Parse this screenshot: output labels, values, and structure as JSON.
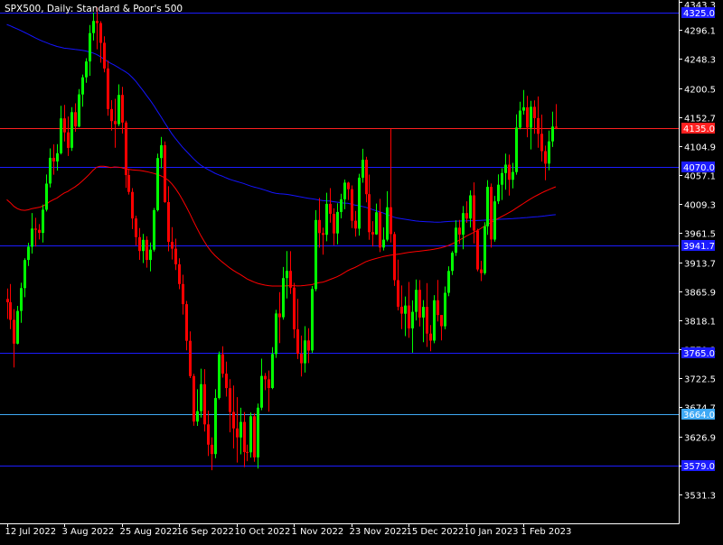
{
  "header": {
    "title": "SPX500, Daily:  Standard & Poor's 500"
  },
  "chart_data": {
    "type": "candlestick",
    "symbol": "SPX500",
    "timeframe": "Daily",
    "instrument": "Standard & Poor's 500",
    "y_ticks": [
      "4343.3",
      "4296.1",
      "4248.3",
      "4200.5",
      "4152.7",
      "4104.9",
      "4057.1",
      "4009.3",
      "3961.5",
      "3913.7",
      "3865.9",
      "3818.1",
      "3770.3",
      "3722.5",
      "3674.7",
      "3626.9",
      "3579.1",
      "3531.3"
    ],
    "ylim": [
      3483.6,
      4345.6
    ],
    "x_ticks": [
      {
        "label": "12 Jul 2022",
        "bar": 0
      },
      {
        "label": "3 Aug 2022",
        "bar": 16
      },
      {
        "label": "25 Aug 2022",
        "bar": 32
      },
      {
        "label": "16 Sep 2022",
        "bar": 48
      },
      {
        "label": "10 Oct 2022",
        "bar": 64
      },
      {
        "label": "1 Nov 2022",
        "bar": 80
      },
      {
        "label": "23 Nov 2022",
        "bar": 96
      },
      {
        "label": "15 Dec 2022",
        "bar": 112
      },
      {
        "label": "10 Jan 2023",
        "bar": 128
      },
      {
        "label": "1 Feb 2023",
        "bar": 144
      }
    ],
    "horizontal_lines": [
      {
        "value": 4325.0,
        "label": "4325.0",
        "color": "#1c1cff",
        "label_bg": "#1c1cff"
      },
      {
        "value": 4135.0,
        "label": "4135.0",
        "color": "#ff2020",
        "label_bg": "#ff2020"
      },
      {
        "value": 4070.0,
        "label": "4070.0",
        "color": "#1c1cff",
        "label_bg": "#1c1cff"
      },
      {
        "value": 3941.7,
        "label": "3941.7",
        "color": "#1c1cff",
        "label_bg": "#1c1cff"
      },
      {
        "value": 3765.0,
        "label": "3765.0",
        "color": "#1c1cff",
        "label_bg": "#1c1cff"
      },
      {
        "value": 3664.0,
        "label": "3664.0",
        "color": "#3fa9f5",
        "label_bg": "#3fa9f5"
      },
      {
        "value": 3579.0,
        "label": "3579.0",
        "color": "#1c1cff",
        "label_bg": "#1c1cff"
      }
    ],
    "colors": {
      "background": "#000000",
      "up": "#00ff00",
      "down": "#ff0000",
      "text": "#ffffff",
      "ma_fast": "#ff0000",
      "ma_slow": "#1414ff"
    },
    "candles": [
      [
        3853.2,
        3870.5,
        3820.2,
        3847.7
      ],
      [
        3847.7,
        3877.9,
        3803.6,
        3818.7
      ],
      [
        3818.7,
        3836.4,
        3740.3,
        3779.6
      ],
      [
        3779.6,
        3841.8,
        3778.4,
        3833.5
      ],
      [
        3833.5,
        3879.8,
        3814.0,
        3871.1
      ],
      [
        3871.1,
        3920.2,
        3856.1,
        3917.3
      ],
      [
        3917.3,
        3945.8,
        3907.6,
        3939.2
      ],
      [
        3939.2,
        3994.7,
        3928.0,
        3969.1
      ],
      [
        3969.1,
        3986.8,
        3939.4,
        3967.0
      ],
      [
        3967.0,
        3976.4,
        3951.1,
        3962.0
      ],
      [
        3962.0,
        4008.7,
        3946.3,
        4000.2
      ],
      [
        4000.2,
        4058.2,
        3997.3,
        4043.2
      ],
      [
        4043.2,
        4101.1,
        4036.8,
        4085.6
      ],
      [
        4085.6,
        4107.8,
        4057.8,
        4079.7
      ],
      [
        4079.7,
        4108.2,
        4064.6,
        4093.2
      ],
      [
        4093.2,
        4171.3,
        4091.3,
        4150.6
      ],
      [
        4150.6,
        4172.7,
        4112.6,
        4127.6
      ],
      [
        4127.6,
        4153.8,
        4088.6,
        4102.1
      ],
      [
        4102.1,
        4169.0,
        4096.9,
        4160.8
      ],
      [
        4160.8,
        4175.5,
        4128.6,
        4137.2
      ],
      [
        4137.2,
        4198.8,
        4135.9,
        4190.1
      ],
      [
        4190.1,
        4222.8,
        4169.9,
        4218.3
      ],
      [
        4218.3,
        4249.8,
        4209.2,
        4244.4
      ],
      [
        4244.4,
        4304.4,
        4220.8,
        4291.1
      ],
      [
        4291.1,
        4324.6,
        4278.8,
        4311.1
      ],
      [
        4311.1,
        4333.4,
        4264.4,
        4307.6
      ],
      [
        4307.6,
        4310.6,
        4242.3,
        4275.1
      ],
      [
        4275.1,
        4285.8,
        4226.6,
        4232.8
      ],
      [
        4232.8,
        4245.6,
        4155.0,
        4166.1
      ],
      [
        4166.1,
        4180.6,
        4130.4,
        4146.2
      ],
      [
        4146.2,
        4182.9,
        4102.1,
        4141.2
      ],
      [
        4141.2,
        4206.7,
        4137.9,
        4189.3
      ],
      [
        4189.3,
        4202.6,
        4125.6,
        4143.8
      ],
      [
        4143.8,
        4146.8,
        4036.0,
        4057.3
      ],
      [
        4057.3,
        4067.9,
        4025.1,
        4029.5
      ],
      [
        4029.5,
        4035.8,
        3968.3,
        3985.8
      ],
      [
        3985.8,
        3990.3,
        3941.5,
        3955.0
      ],
      [
        3955.0,
        3970.1,
        3917.5,
        3932.1
      ],
      [
        3932.1,
        3960.2,
        3912.3,
        3950.5
      ],
      [
        3950.5,
        3956.3,
        3904.8,
        3917.5
      ],
      [
        3917.5,
        3946.1,
        3898.5,
        3934.4
      ],
      [
        3934.4,
        4003.1,
        3931.3,
        3999.5
      ],
      [
        3999.5,
        4092.6,
        3997.2,
        4085.2
      ],
      [
        4085.2,
        4120.0,
        4068.4,
        4106.3
      ],
      [
        4106.3,
        4112.6,
        4011.6,
        4012.7
      ],
      [
        4012.7,
        4038.9,
        3931.7,
        3947.3
      ],
      [
        3947.3,
        3971.5,
        3918.1,
        3936.0
      ],
      [
        3936.0,
        3952.5,
        3901.0,
        3910.3
      ],
      [
        3910.3,
        3920.3,
        3869.3,
        3877.7
      ],
      [
        3877.7,
        3893.0,
        3827.5,
        3844.6
      ],
      [
        3844.6,
        3849.9,
        3768.5,
        3784.3
      ],
      [
        3784.3,
        3799.9,
        3722.9,
        3726.2
      ],
      [
        3726.2,
        3729.7,
        3644.2,
        3651.3
      ],
      [
        3651.3,
        3704.4,
        3644.1,
        3668.4
      ],
      [
        3668.4,
        3738.4,
        3657.9,
        3712.7
      ],
      [
        3712.7,
        3737.6,
        3634.7,
        3646.6
      ],
      [
        3646.6,
        3669.2,
        3594.4,
        3613.1
      ],
      [
        3613.1,
        3625.3,
        3571.2,
        3597.8
      ],
      [
        3597.8,
        3704.4,
        3590.7,
        3690.1
      ],
      [
        3690.1,
        3766.5,
        3687.8,
        3761.9
      ],
      [
        3761.9,
        3775.4,
        3723.6,
        3730.1
      ],
      [
        3730.1,
        3749.9,
        3692.4,
        3706.3
      ],
      [
        3706.3,
        3720.9,
        3633.6,
        3667.1
      ],
      [
        3667.1,
        3710.7,
        3606.9,
        3639.9
      ],
      [
        3639.9,
        3691.5,
        3583.8,
        3625.2
      ],
      [
        3625.2,
        3674.0,
        3597.3,
        3650.7
      ],
      [
        3650.7,
        3667.0,
        3576.3,
        3601.1
      ],
      [
        3601.1,
        3613.3,
        3586.0,
        3600.5
      ],
      [
        3600.5,
        3666.1,
        3592.0,
        3660.0
      ],
      [
        3660.0,
        3664.7,
        3585.1,
        3592.3
      ],
      [
        3592.3,
        3681.0,
        3574.0,
        3674.2
      ],
      [
        3674.2,
        3754.9,
        3670.0,
        3726.5
      ],
      [
        3726.5,
        3731.2,
        3702.9,
        3720.8
      ],
      [
        3720.8,
        3735.4,
        3667.5,
        3706.5
      ],
      [
        3706.5,
        3773.8,
        3704.7,
        3762.6
      ],
      [
        3762.6,
        3835.3,
        3756.2,
        3829.3
      ],
      [
        3829.3,
        3864.5,
        3780.6,
        3823.1
      ],
      [
        3823.1,
        3905.9,
        3819.0,
        3887.6
      ],
      [
        3887.6,
        3932.0,
        3854.0,
        3899.5
      ],
      [
        3899.5,
        3931.8,
        3861.4,
        3871.9
      ],
      [
        3871.9,
        3879.6,
        3788.7,
        3803.1
      ],
      [
        3803.1,
        3853.2,
        3754.2,
        3762.9
      ],
      [
        3762.9,
        3792.9,
        3725.5,
        3747.3
      ],
      [
        3747.3,
        3808.3,
        3731.9,
        3784.9
      ],
      [
        3784.9,
        3805.1,
        3747.6,
        3768.3
      ],
      [
        3768.3,
        3874.5,
        3764.0,
        3869.5
      ],
      [
        3869.5,
        3999.5,
        3865.8,
        3983.3
      ],
      [
        3983.3,
        4019.6,
        3937.6,
        3961.7
      ],
      [
        3961.7,
        3970.5,
        3926.2,
        3958.8
      ],
      [
        3958.8,
        4028.2,
        3948.2,
        4009.8
      ],
      [
        4009.8,
        4035.7,
        3979.0,
        3993.4
      ],
      [
        3993.4,
        4002.4,
        3941.6,
        3961.1
      ],
      [
        3961.1,
        4010.8,
        3943.2,
        3996.5
      ],
      [
        3996.5,
        4026.5,
        3985.9,
        4017.3
      ],
      [
        4017.3,
        4049.9,
        4000.9,
        4044.8
      ],
      [
        4044.8,
        4046.1,
        4016.3,
        4034.0
      ],
      [
        4034.0,
        4040.2,
        3970.1,
        3982.1
      ],
      [
        3982.1,
        3998.3,
        3955.8,
        3969.1
      ],
      [
        3969.1,
        4059.3,
        3957.5,
        4053.0
      ],
      [
        4053.0,
        4100.5,
        4044.6,
        4082.6
      ],
      [
        4082.6,
        4087.3,
        4012.4,
        4025.8
      ],
      [
        4025.8,
        4058.0,
        3950.7,
        3963.3
      ],
      [
        3963.3,
        3981.3,
        3939.7,
        3959.4
      ],
      [
        3959.4,
        4010.3,
        3958.7,
        3996.0
      ],
      [
        3996.0,
        4018.0,
        3930.4,
        3937.9
      ],
      [
        3937.9,
        3971.1,
        3933.0,
        3950.8
      ],
      [
        3950.8,
        4030.7,
        3948.1,
        4004.2
      ],
      [
        4004.2,
        4133.5,
        3946.2,
        3960.1
      ],
      [
        3960.1,
        3963.8,
        3874.6,
        3884.1
      ],
      [
        3884.1,
        3917.9,
        3834.3,
        3840.4
      ],
      [
        3840.4,
        3875.3,
        3803.4,
        3828.9
      ],
      [
        3828.9,
        3857.3,
        3792.0,
        3842.4
      ],
      [
        3842.4,
        3881.1,
        3789.1,
        3804.8
      ],
      [
        3804.8,
        3850.8,
        3764.6,
        3832.0
      ],
      [
        3832.0,
        3885.1,
        3817.8,
        3868.2
      ],
      [
        3868.2,
        3884.3,
        3807.9,
        3822.5
      ],
      [
        3822.5,
        3851.3,
        3782.0,
        3840.1
      ],
      [
        3840.1,
        3879.4,
        3774.2,
        3796.1
      ],
      [
        3796.1,
        3810.2,
        3767.0,
        3784.5
      ],
      [
        3784.5,
        3859.5,
        3780.2,
        3851.0
      ],
      [
        3851.0,
        3884.4,
        3816.2,
        3826.8
      ],
      [
        3826.8,
        3826.9,
        3785.0,
        3808.3
      ],
      [
        3808.3,
        3873.7,
        3803.3,
        3863.4
      ],
      [
        3863.4,
        3907.0,
        3857.8,
        3899.3
      ],
      [
        3899.3,
        3931.9,
        3892.7,
        3929.3
      ],
      [
        3929.3,
        3982.8,
        3924.1,
        3970.6
      ],
      [
        3970.6,
        3983.3,
        3944.1,
        3959.1
      ],
      [
        3959.1,
        4006.1,
        3935.0,
        3994.6
      ],
      [
        3994.6,
        4014.1,
        3978.5,
        3985.7
      ],
      [
        3985.7,
        4032.0,
        3970.9,
        4023.9
      ],
      [
        4023.9,
        4045.2,
        3944.8,
        3965.9
      ],
      [
        3965.9,
        3968.9,
        3898.5,
        3901.8
      ],
      [
        3901.8,
        3916.1,
        3882.6,
        3895.7
      ],
      [
        3895.7,
        3979.6,
        3893.1,
        3972.9
      ],
      [
        3972.9,
        4048.9,
        3958.8,
        4037.8
      ],
      [
        4037.8,
        4043.3,
        3937.8,
        3951.1
      ],
      [
        3951.1,
        4023.0,
        3947.4,
        4013.9
      ],
      [
        4013.9,
        4058.5,
        4009.6,
        4041.3
      ],
      [
        4041.3,
        4068.4,
        4016.2,
        4060.5
      ],
      [
        4060.5,
        4092.5,
        4033.1,
        4074.3
      ],
      [
        4074.3,
        4090.9,
        4023.6,
        4049.5
      ],
      [
        4049.5,
        4077.3,
        4035.5,
        4062.3
      ],
      [
        4062.3,
        4157.3,
        4057.8,
        4135.5
      ],
      [
        4135.5,
        4178.0,
        4132.8,
        4163.4
      ],
      [
        4163.4,
        4197.3,
        4156.9,
        4168.9
      ],
      [
        4168.9,
        4187.8,
        4119.6,
        4135.4
      ],
      [
        4135.4,
        4179.6,
        4099.5,
        4169.7
      ],
      [
        4169.7,
        4180.3,
        4125.3,
        4151.1
      ],
      [
        4151.1,
        4186.7,
        4102.1,
        4125.2
      ],
      [
        4125.2,
        4156.9,
        4079.6,
        4096.7
      ],
      [
        4096.7,
        4105.7,
        4048.6,
        4076.1
      ],
      [
        4076.1,
        4130.6,
        4065.2,
        4112.7
      ],
      [
        4112.7,
        4161.7,
        4103.5,
        4137.1
      ],
      [
        4137.1,
        4174.1,
        4132.8,
        4135.0
      ]
    ],
    "ma_fast": [
      4016.9,
      4011.7,
      4005.7,
      4001.8,
      3999.7,
      3999.2,
      4000.1,
      4002.0,
      4003.0,
      4004.1,
      4006.0,
      4009.3,
      4013.6,
      4016.7,
      4019.6,
      4023.9,
      4027.7,
      4030.3,
      4034.3,
      4037.7,
      4042.1,
      4047.1,
      4052.6,
      4058.5,
      4064.9,
      4070.0,
      4071.7,
      4071.8,
      4070.8,
      4069.6,
      4070.7,
      4070.2,
      4069.4,
      4067.5,
      4066.7,
      4065.8,
      4065.3,
      4064.8,
      4063.9,
      4062.9,
      4061.5,
      4060.0,
      4058.1,
      4055.9,
      4052.9,
      4048.7,
      4042.8,
      4035.3,
      4026.3,
      4016.4,
      4005.4,
      3993.8,
      3981.8,
      3969.9,
      3958.4,
      3948.2,
      3939.1,
      3931.2,
      3924.8,
      3919.4,
      3914.3,
      3909.6,
      3905.0,
      3900.8,
      3897.1,
      3893.7,
      3890.0,
      3886.1,
      3883.4,
      3880.9,
      3878.8,
      3877.3,
      3876.0,
      3875.1,
      3874.4,
      3874.4,
      3874.4,
      3874.5,
      3874.8,
      3875.0,
      3875.0,
      3874.6,
      3874.8,
      3875.4,
      3876.1,
      3876.7,
      3878.5,
      3879.9,
      3880.7,
      3882.7,
      3885.0,
      3887.2,
      3889.7,
      3892.6,
      3896.1,
      3899.7,
      3902.5,
      3905.0,
      3908.0,
      3911.2,
      3914.3,
      3916.6,
      3918.3,
      3920.0,
      3921.6,
      3923.2,
      3924.3,
      3925.3,
      3926.1,
      3927.0,
      3927.9,
      3928.8,
      3929.7,
      3930.5,
      3931.2,
      3931.9,
      3932.6,
      3933.3,
      3934.1,
      3935.0,
      3936.1,
      3937.5,
      3939.1,
      3941.1,
      3943.6,
      3946.4,
      3949.5,
      3952.9,
      3956.5,
      3959.5,
      3962.4,
      3965.6,
      3968.9,
      3972.5,
      3976.0,
      3979.4,
      3982.8,
      3986.0,
      3989.2,
      3992.2,
      3995.4,
      3998.9,
      4002.7,
      4006.6,
      4010.5,
      4014.3,
      4018.1,
      4021.5,
      4024.6,
      4027.7,
      4030.5,
      4033.1,
      4035.6,
      4038.0
    ],
    "ma_slow": [
      4305.3,
      4302.9,
      4300.3,
      4297.7,
      4294.9,
      4292.1,
      4289.2,
      4286.1,
      4283.1,
      4280.4,
      4277.7,
      4275.4,
      4273.1,
      4271.1,
      4269.0,
      4267.7,
      4266.2,
      4265.6,
      4265.0,
      4264.2,
      4263.5,
      4262.8,
      4261.6,
      4260.1,
      4258.3,
      4256.0,
      4252.6,
      4248.5,
      4244.9,
      4241.3,
      4238.3,
      4234.7,
      4231.2,
      4227.7,
      4223.6,
      4217.8,
      4211.5,
      4203.8,
      4196.1,
      4188.2,
      4180.2,
      4171.5,
      4162.3,
      4153.1,
      4143.5,
      4134.3,
      4125.3,
      4117.5,
      4110.2,
      4103.0,
      4096.8,
      4090.6,
      4084.4,
      4078.8,
      4073.8,
      4070.0,
      4066.6,
      4063.5,
      4060.3,
      4057.7,
      4055.6,
      4052.9,
      4050.6,
      4048.6,
      4046.8,
      4045.1,
      4043.4,
      4041.2,
      4039.1,
      4037.4,
      4036.0,
      4034.2,
      4032.5,
      4030.5,
      4028.5,
      4027.3,
      4026.4,
      4026.0,
      4025.5,
      4024.6,
      4023.6,
      4022.4,
      4021.3,
      4020.1,
      4019.1,
      4018.2,
      4017.3,
      4016.2,
      4015.3,
      4014.8,
      4014.4,
      4013.5,
      4012.7,
      4011.9,
      4011.1,
      4010.7,
      4009.5,
      4007.9,
      4006.9,
      4005.7,
      4004.2,
      4002.3,
      4000.4,
      3998.4,
      3996.5,
      3994.5,
      3992.2,
      3989.9,
      3987.7,
      3986.3,
      3985.3,
      3984.5,
      3983.5,
      3982.6,
      3981.7,
      3981.1,
      3980.8,
      3980.5,
      3980.1,
      3979.8,
      3979.7,
      3979.8,
      3980.3,
      3980.7,
      3981.0,
      3981.3,
      3981.5,
      3981.7,
      3981.8,
      3982.0,
      3982.1,
      3982.3,
      3982.6,
      3983.0,
      3983.4,
      3983.7,
      3984.0,
      3984.3,
      3984.6,
      3984.9,
      3985.2,
      3985.5,
      3985.9,
      3986.3,
      3986.8,
      3987.3,
      3987.8,
      3988.3,
      3988.8,
      3989.4,
      3990.0,
      3990.7,
      3991.4,
      3992.1
    ]
  }
}
